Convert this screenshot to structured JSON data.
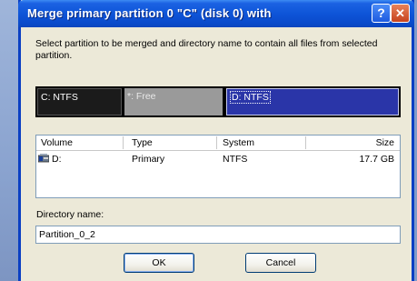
{
  "dialog": {
    "title": "Merge primary partition 0  \"C\" (disk 0)  with",
    "help_glyph": "?",
    "close_glyph": "✕",
    "instructions": "Select partition to be merged and directory name to contain all files from selected partition."
  },
  "partitions": [
    {
      "label": "C: NTFS",
      "color": "#1b1b1b",
      "selected": false
    },
    {
      "label": "*: Free",
      "color": "#9a9a9a",
      "selected": false
    },
    {
      "label": "D: NTFS",
      "color": "#2a35a8",
      "selected": true
    }
  ],
  "list": {
    "columns": [
      "Volume",
      "Type",
      "System",
      "Size"
    ],
    "rows": [
      {
        "volume": "D:",
        "type": "Primary",
        "system": "NTFS",
        "size": "17.7 GB",
        "icon": "drive-icon"
      }
    ]
  },
  "directory": {
    "label": "Directory name:",
    "value": "Partition_0_2"
  },
  "buttons": {
    "ok": "OK",
    "cancel": "Cancel"
  },
  "colors": {
    "titlebar": "#0e55d8",
    "dialog_bg": "#ece9d8",
    "selected_partition": "#2a35a8"
  }
}
